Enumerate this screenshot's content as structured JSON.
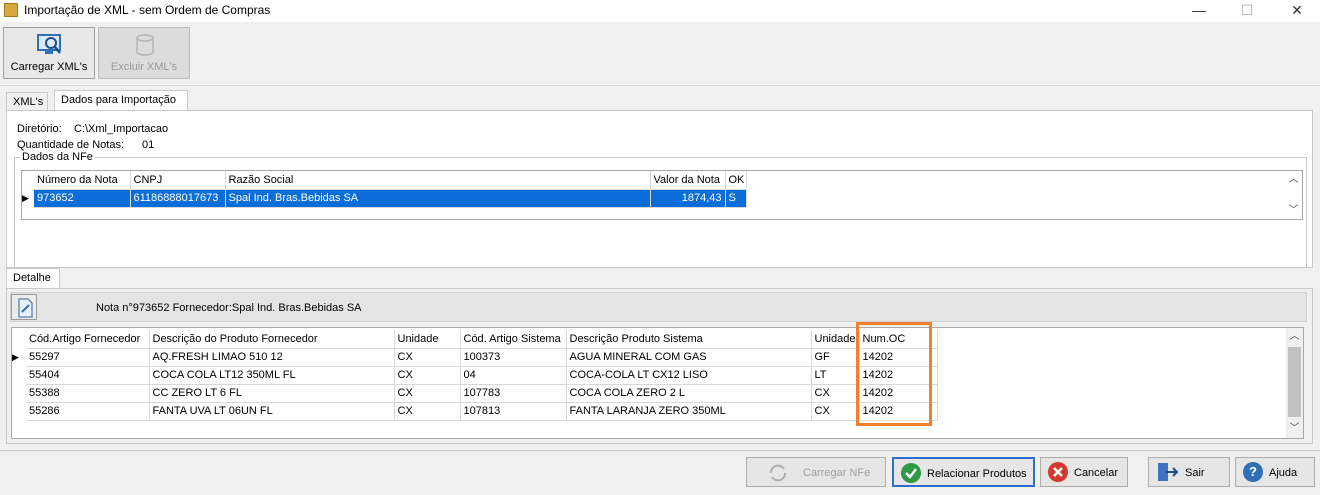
{
  "window": {
    "title": "Importação de XML - sem Ordem de Compras",
    "min": "—",
    "max": "☐",
    "close": "✕"
  },
  "toolbar": {
    "load_label": "Carregar XML's",
    "delete_label": "Excluir XML's"
  },
  "tabs": {
    "xmls": "XML's",
    "dados": "Dados para Importação"
  },
  "info": {
    "dir_label": "Diretório:",
    "dir_value": "C:\\Xml_Importacao",
    "qty_label": "Quantidade de Notas:",
    "qty_value": "01"
  },
  "nfe": {
    "group_title": "Dados da NFe",
    "headers": [
      "Número da Nota",
      "CNPJ",
      "Razão Social",
      "Valor da Nota",
      "OK"
    ],
    "rows": [
      [
        "973652",
        "61186888017673",
        "Spal Ind. Bras.Bebidas SA",
        "1874,43",
        "S"
      ]
    ]
  },
  "detail": {
    "tab": "Detalhe",
    "note_text": "Nota n°973652 Fornecedor:Spal Ind. Bras.Bebidas SA",
    "headers": [
      "Cód.Artigo Fornecedor",
      "Descrição do Produto Fornecedor",
      "Unidade",
      "Cód. Artigo Sistema",
      "Descrição Produto Sistema",
      "Unidade",
      "Num.OC"
    ],
    "rows": [
      [
        "55297",
        "AQ.FRESH LIMAO 510 12",
        "CX",
        "100373",
        "AGUA MINERAL COM GAS",
        "GF",
        "14202"
      ],
      [
        "55404",
        "COCA COLA LT12 350ML FL",
        "CX",
        "04",
        "COCA-COLA LT CX12 LISO",
        "LT",
        "14202"
      ],
      [
        "55388",
        "CC ZERO LT 6 FL",
        "CX",
        "107783",
        "COCA COLA ZERO 2 L",
        "CX",
        "14202"
      ],
      [
        "55286",
        "FANTA UVA LT 06UN FL",
        "CX",
        "107813",
        "FANTA LARANJA ZERO 350ML",
        "CX",
        "14202"
      ]
    ]
  },
  "buttons": {
    "carregar_nfe": "Carregar NFe",
    "relacionar": "Relacionar Produtos",
    "cancelar": "Cancelar",
    "sair": "Sair",
    "ajuda": "Ajuda"
  },
  "colors": {
    "selection": "#0a6dd9",
    "highlight": "#f0802a"
  }
}
